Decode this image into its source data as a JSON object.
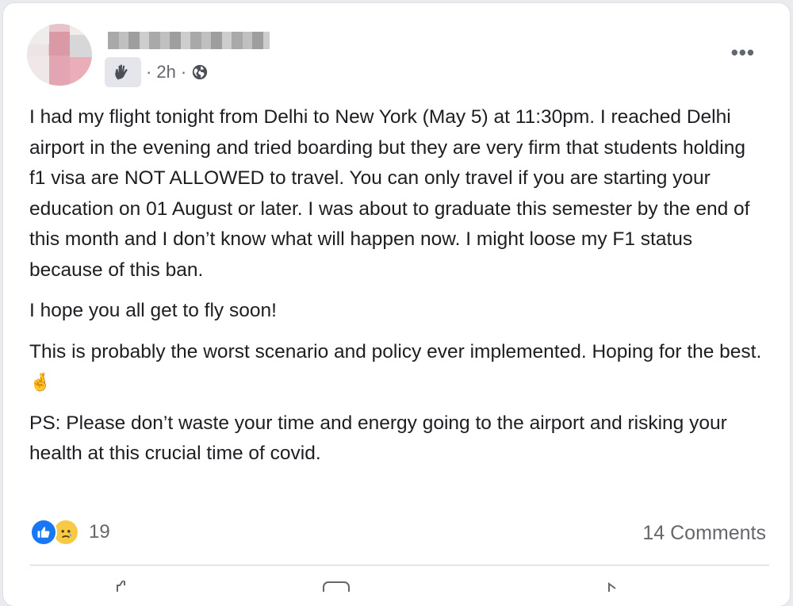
{
  "post": {
    "time_meta": "2h",
    "separator": "·",
    "paragraphs": [
      "I had my flight tonight from Delhi to New York (May 5) at 11:30pm. I reached Delhi airport in the evening and tried boarding but they are very firm that students holding f1 visa are NOT ALLOWED to travel. You can only travel if you are starting your education on 01 August or later. I was about to graduate this semester by the end of this month and I don’t know what will happen now. I might loose my F1 status because of this ban.",
      "I hope you all get to fly soon!",
      "This is probably the worst scenario and policy ever implemented. Hoping for the best.",
      "PS: Please don’t waste your time and energy going to the airport and risking your health at this crucial time of covid."
    ],
    "finger_emoji": "🤞",
    "more_label": "•••"
  },
  "footer": {
    "reaction_count": "19",
    "comments_label": "14 Comments"
  },
  "icons": {
    "audience": "wave-hand-icon",
    "privacy": "globe-icon",
    "like": "thumbs-up-icon",
    "sad": "sad-face-icon"
  },
  "colors": {
    "like_blue": "#1877f2",
    "sad_yellow": "#f7c944",
    "meta_gray": "#65676b",
    "text": "#1c1e21"
  }
}
